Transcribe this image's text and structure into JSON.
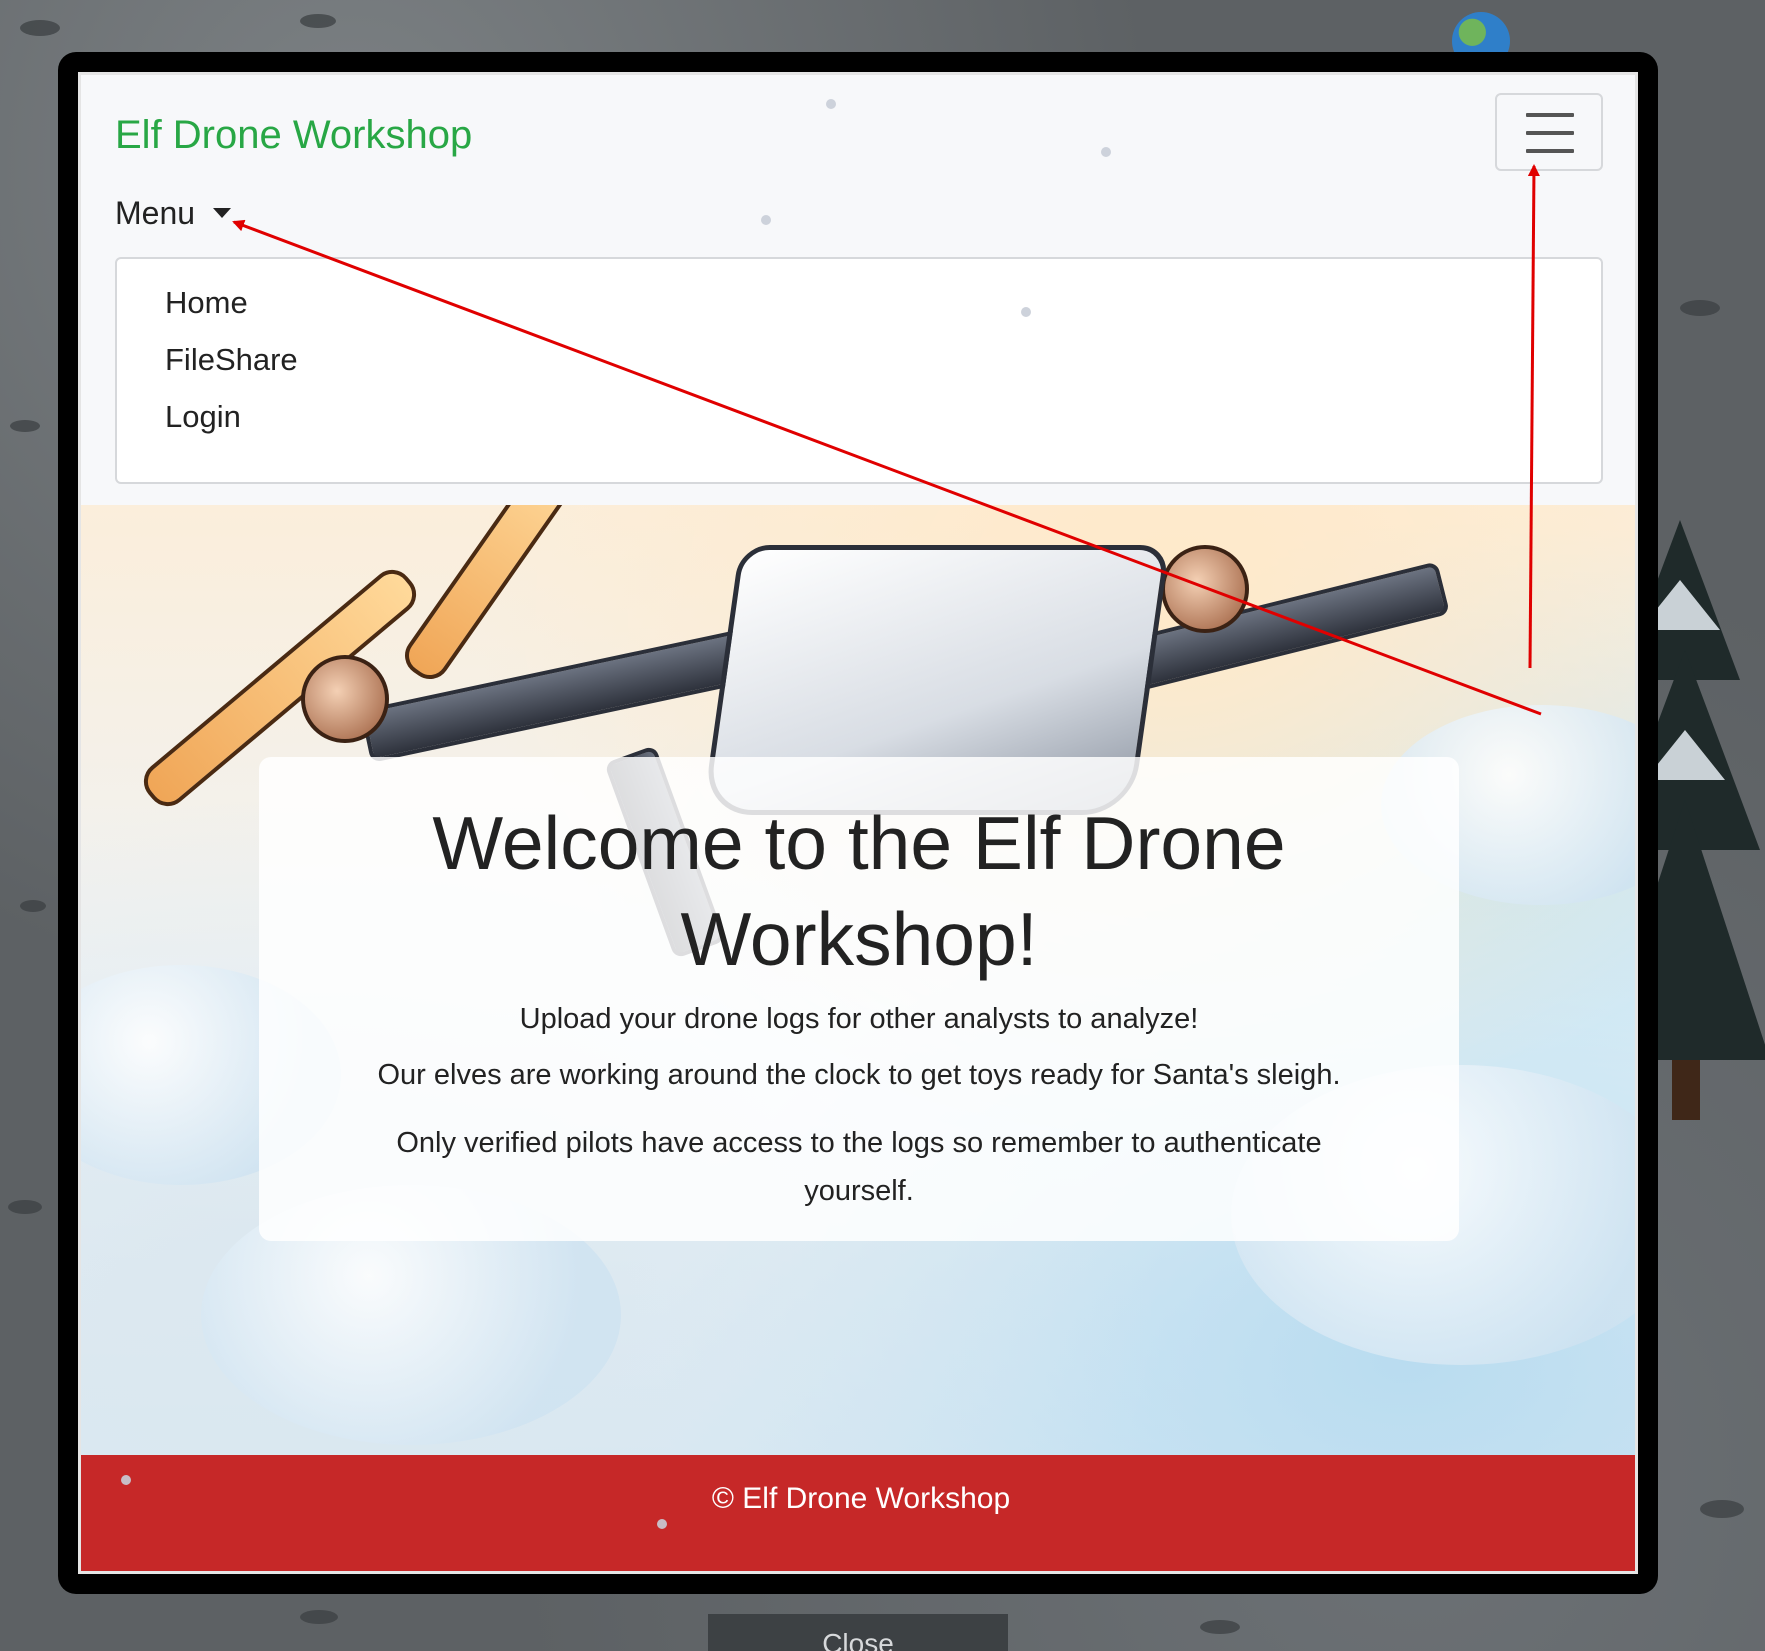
{
  "navbar": {
    "brand": "Elf Drone Workshop",
    "menu_label": "Menu",
    "menu_items": [
      {
        "label": "Home"
      },
      {
        "label": "FileShare"
      },
      {
        "label": "Login"
      }
    ]
  },
  "hero": {
    "title": "Welcome to the Elf Drone Workshop!",
    "line1": "Upload your drone logs for other analysts to analyze!",
    "line2": "Our elves are working around the clock to get toys ready for Santa's sleigh.",
    "line3": "Only verified pilots have access to the logs so remember to authenticate yourself."
  },
  "footer": {
    "text": "© Elf Drone Workshop"
  },
  "modal": {
    "close_label": "Close"
  },
  "icons": {
    "toggler": "hamburger-icon",
    "caret": "caret-down-icon"
  },
  "colors": {
    "brand": "#28a745",
    "footer_bg": "#c62828",
    "annotation": "#e00000"
  }
}
